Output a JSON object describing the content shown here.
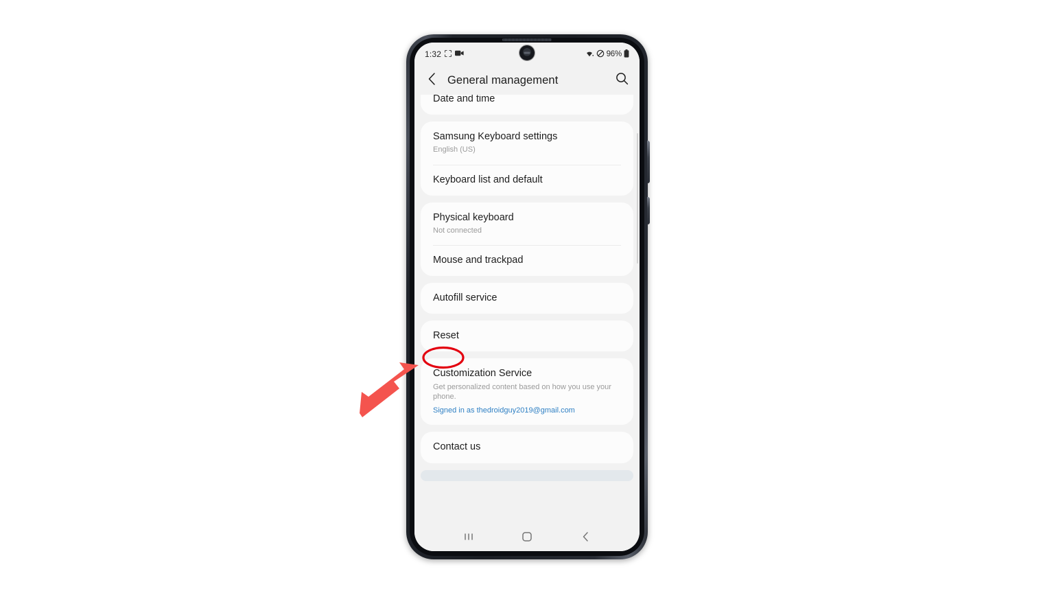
{
  "device": {
    "name": "samsung-galaxy-phone",
    "hardware": {
      "earpiece": "speaker-grille",
      "front_camera": "punch-hole-camera",
      "side_buttons": [
        "volume-rocker",
        "power-button"
      ]
    }
  },
  "status_bar": {
    "clock": "1:32",
    "left_icons": [
      "screen-capture-icon",
      "video-recorder-icon"
    ],
    "right_icons": [
      "wifi-icon",
      "mute-icon"
    ],
    "battery_percent": "96%",
    "battery_icon": "battery-full-icon"
  },
  "app_bar": {
    "back_icon": "chevron-left-icon",
    "title": "General management",
    "search_icon": "search-icon"
  },
  "settings": {
    "groups": [
      {
        "id": "date-time-group",
        "clipped": true,
        "rows": [
          {
            "id": "date-and-time",
            "title": "Date and time"
          }
        ]
      },
      {
        "id": "keyboard-group",
        "clipped": false,
        "rows": [
          {
            "id": "samsung-keyboard-settings",
            "title": "Samsung Keyboard settings",
            "subtitle": "English (US)"
          },
          {
            "id": "keyboard-list-and-default",
            "title": "Keyboard list and default"
          }
        ]
      },
      {
        "id": "input-devices-group",
        "clipped": false,
        "rows": [
          {
            "id": "physical-keyboard",
            "title": "Physical keyboard",
            "subtitle": "Not connected"
          },
          {
            "id": "mouse-and-trackpad",
            "title": "Mouse and trackpad"
          }
        ]
      },
      {
        "id": "autofill-group",
        "clipped": false,
        "rows": [
          {
            "id": "autofill-service",
            "title": "Autofill service"
          }
        ]
      },
      {
        "id": "reset-group",
        "clipped": false,
        "rows": [
          {
            "id": "reset",
            "title": "Reset"
          }
        ]
      },
      {
        "id": "customization-service-group",
        "clipped": false,
        "rows": [
          {
            "id": "customization-service",
            "title": "Customization Service",
            "subtitle": "Get personalized content based on how you use your phone.",
            "link": "Signed in as thedroidguy2019@gmail.com"
          }
        ]
      },
      {
        "id": "contact-us-group",
        "clipped": false,
        "rows": [
          {
            "id": "contact-us",
            "title": "Contact us"
          }
        ]
      }
    ]
  },
  "nav_bar": {
    "recents_icon": "recents-icon",
    "home_icon": "home-icon",
    "back_icon": "back-chevron-icon"
  },
  "annotations": {
    "highlight_target": "Reset",
    "ellipse_color": "#e3000f",
    "arrow_color": "#f4544e"
  }
}
